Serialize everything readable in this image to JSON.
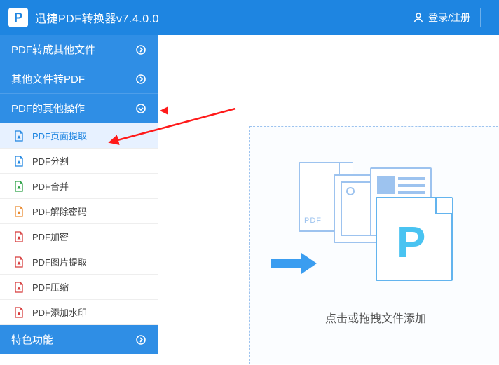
{
  "titlebar": {
    "app_title": "迅捷PDF转换器v7.4.0.0",
    "login_label": "登录/注册"
  },
  "sidebar": {
    "cat_pdf_to_other": "PDF转成其他文件",
    "cat_other_to_pdf": "其他文件转PDF",
    "cat_pdf_ops": "PDF的其他操作",
    "cat_feature": "特色功能",
    "ops": [
      {
        "label": "PDF页面提取",
        "color": "#1e85e1",
        "active": true
      },
      {
        "label": "PDF分割",
        "color": "#1e85e1",
        "active": false
      },
      {
        "label": "PDF合并",
        "color": "#2aa043",
        "active": false
      },
      {
        "label": "PDF解除密码",
        "color": "#e98a2f",
        "active": false
      },
      {
        "label": "PDF加密",
        "color": "#d63b3b",
        "active": false
      },
      {
        "label": "PDF图片提取",
        "color": "#d63b3b",
        "active": false
      },
      {
        "label": "PDF压缩",
        "color": "#d63b3b",
        "active": false
      },
      {
        "label": "PDF添加水印",
        "color": "#d63b3b",
        "active": false
      }
    ]
  },
  "main": {
    "dropzone_text": "点击或拖拽文件添加",
    "pdf_label": "PDF"
  }
}
